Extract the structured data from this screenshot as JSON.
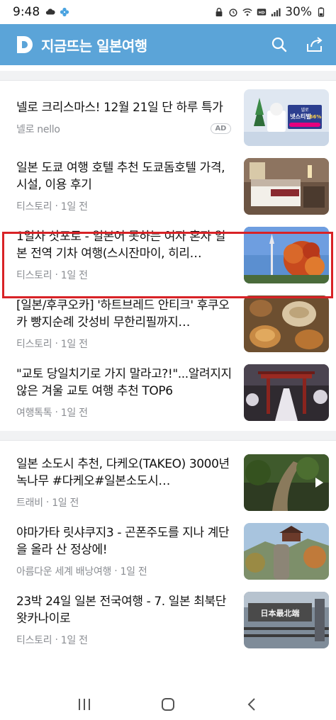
{
  "status_bar": {
    "time": "9:48",
    "battery": "30%",
    "icons": [
      "cloud-icon",
      "clover-icon",
      "lock-icon",
      "alarm-icon",
      "wifi-icon",
      "hd-voice-icon",
      "signal-icon"
    ]
  },
  "header": {
    "logo_letter": "D",
    "title": "지금뜨는 일본여행",
    "accent_color": "#5ba4d8"
  },
  "feed": {
    "section1": [
      {
        "title": "넬로 크리스마스! 12월 21일 단 하루 특가",
        "source": "넬로 nello",
        "time": "",
        "ad": "AD"
      },
      {
        "title": "일본 도쿄 여행 호텔 추천 도쿄돔호텔 가격, 시설, 이용 후기",
        "source": "티스토리",
        "time": "1일 전"
      },
      {
        "title": "1일차 삿포로 - 일본어 못하는 여자 혼자 일본 전역 기차 여행(스시잔마이, 히리…",
        "source": "티스토리",
        "time": "1일 전"
      },
      {
        "title": "[일본/후쿠오카] '하트브레드 안티크' 후쿠오카 빵지순례 갓성비 무한리필까지…",
        "source": "티스토리",
        "time": "1일 전"
      },
      {
        "title": "\"교토 당일치기로 가지 말라고?!\"...알려지지 않은 겨울 교토 여행 추천 TOP6",
        "source": "여행톡톡",
        "time": "1일 전"
      }
    ],
    "section2": [
      {
        "title": "일본 소도시 추천, 다케오(TAKEO) 3000년 녹나무 #다케오#일본소도시…",
        "source": "트래비",
        "time": "1일 전"
      },
      {
        "title": "야마가타 릿샤쿠지3 - 곤폰주도를 지나 계단을 올라 산 정상에!",
        "source": "아름다운 세계 배낭여행",
        "time": "1일 전"
      },
      {
        "title": "23박 24일 일본 전국여행 - 7. 일본 최북단 왓카나이로",
        "source": "티스토리",
        "time": "1일 전"
      }
    ],
    "ad_thumb": {
      "brand": "넬로",
      "line1": "넷스티벌",
      "discount": "66%"
    },
    "sign_thumb_text": "日本最北端"
  }
}
